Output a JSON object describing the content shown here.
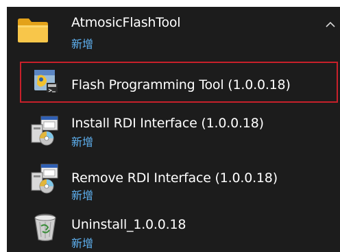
{
  "group": {
    "title": "AtmosicFlashTool",
    "badge": "新增",
    "icon": "folder-icon",
    "toggle_icon": "chevron-up-icon"
  },
  "items": [
    {
      "label": "Flash Programming Tool (1.0.0.18)",
      "badge": "",
      "icon": "flash-tool-icon",
      "selected": true
    },
    {
      "label": "Install RDI Interface (1.0.0.18)",
      "badge": "新增",
      "icon": "installer-icon"
    },
    {
      "label": "Remove RDI Interface (1.0.0.18)",
      "badge": "新增",
      "icon": "installer-icon"
    },
    {
      "label": "Uninstall_1.0.0.18",
      "badge": "新增",
      "icon": "recycle-bin-icon"
    }
  ],
  "colors": {
    "background": "#1c1c1c",
    "badge_text": "#5fb2f2",
    "selection_border": "#c8202a"
  }
}
